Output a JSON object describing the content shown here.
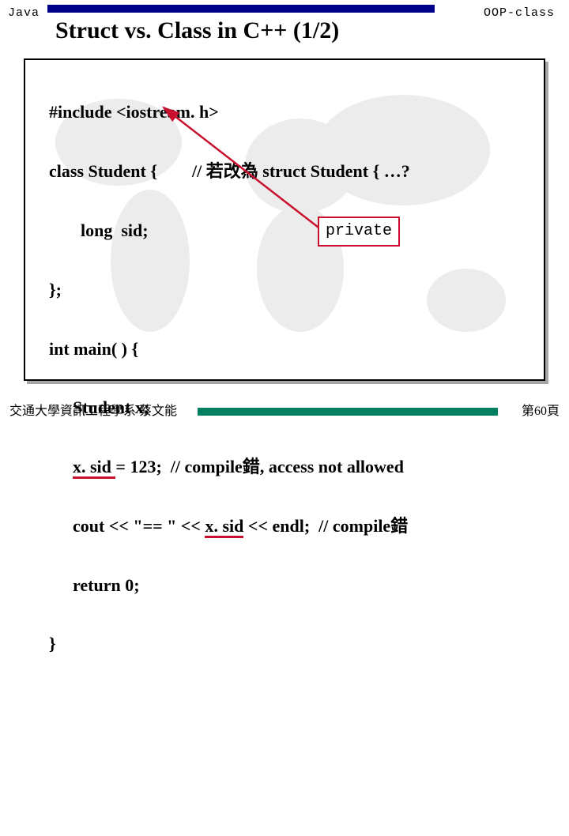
{
  "header": {
    "left_label": "Java",
    "right_label": "OOP-class",
    "title": "Struct vs. Class    in C++ (1/2)"
  },
  "code": {
    "l1": "#include <iostream. h>",
    "l2a": "class Student {        // ",
    "l2b": "若改為",
    "l2c": " struct Student { …?",
    "l3": "long  sid;",
    "l4": "};",
    "l5": "int main( ) {",
    "l6": "Student x;",
    "l7a": "x. sid ",
    "l7b": "= 123;  // compile",
    "l7c": "錯",
    "l7d": ", access not allowed",
    "l8a": "cout << \"== \" << ",
    "l8b": "x. sid",
    "l8c": " << endl;  // compile",
    "l8d": "錯",
    "l9": "return 0;",
    "l10": "}"
  },
  "annotation": {
    "private_label": "private"
  },
  "footer": {
    "left": "交通大學資訊工程學系  蔡文能",
    "right": "第60頁"
  }
}
